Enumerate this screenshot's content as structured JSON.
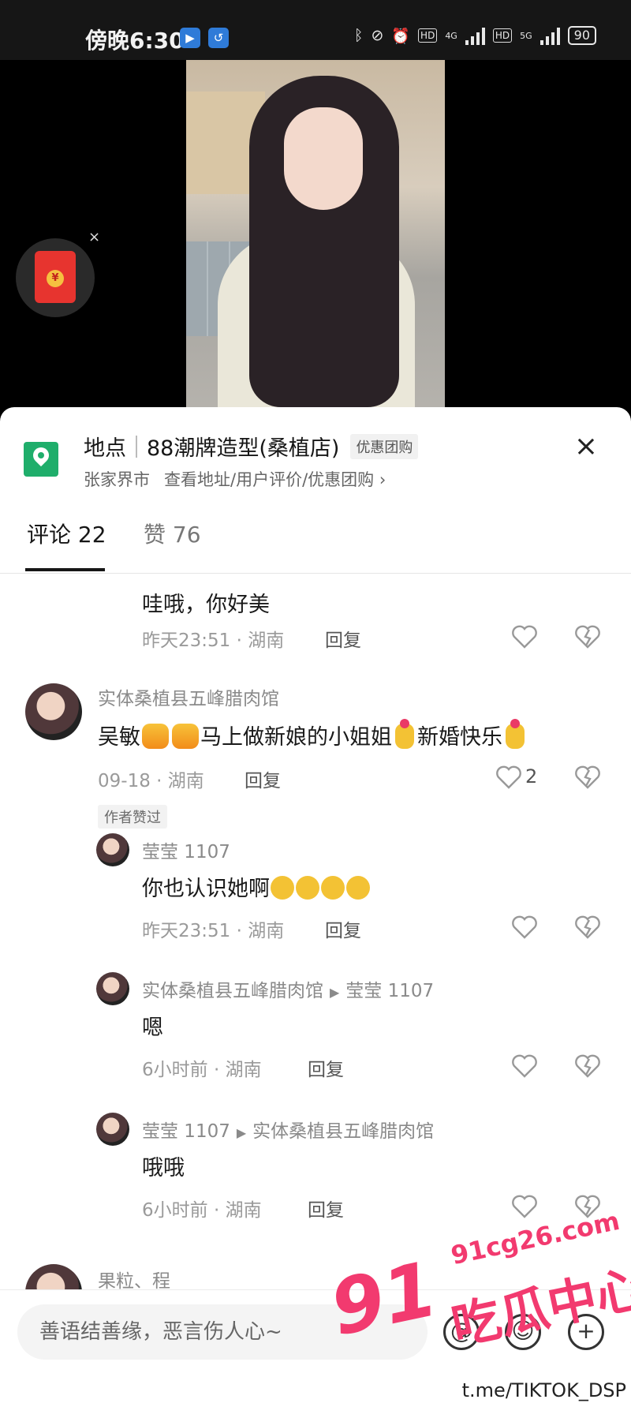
{
  "status_bar": {
    "time": "傍晚6:30",
    "battery": "90",
    "net_4g": "4G",
    "net_5g": "5G",
    "hd": "HD"
  },
  "location": {
    "label": "地点",
    "name": "88潮牌造型(桑植店)",
    "badge": "优惠团购",
    "city": "张家界市",
    "links": "查看地址/用户评价/优惠团购 ›"
  },
  "tabs": {
    "comments": "评论 22",
    "likes": "赞 76"
  },
  "comments": [
    {
      "text": "哇哦，你好美",
      "time": "昨天23:51 · 湖南",
      "reply": "回复"
    },
    {
      "name": "实体桑植县五峰腊肉馆",
      "text_a": "吴敏",
      "text_b": "马上做新娘的小姐姐",
      "text_c": "新婚快乐",
      "time": "09-18 · 湖南",
      "reply": "回复",
      "likes": "2",
      "tag": "作者赞过"
    },
    {
      "name": "莹莹 1107",
      "text": "你也认识她啊",
      "time": "昨天23:51 · 湖南",
      "reply": "回复"
    },
    {
      "name": "实体桑植县五峰腊肉馆",
      "reply_to": "莹莹 1107",
      "text": "嗯",
      "time": "6小时前 · 湖南",
      "reply": "回复"
    },
    {
      "name": "莹莹 1107",
      "reply_to": "实体桑植县五峰腊肉馆",
      "text": "哦哦",
      "time": "6小时前 · 湖南",
      "reply": "回复"
    },
    {
      "name": "果粒、程"
    }
  ],
  "input": {
    "placeholder": "善语结善缘，恶言伤人心~"
  },
  "watermark": {
    "num": "91",
    "cn": "吃瓜中心",
    "url": "91cg26.com",
    "tg": "t.me/TIKTOK_DSP"
  },
  "icons": {
    "close": "×",
    "at": "@",
    "plus": "+",
    "emoji": "☺"
  }
}
